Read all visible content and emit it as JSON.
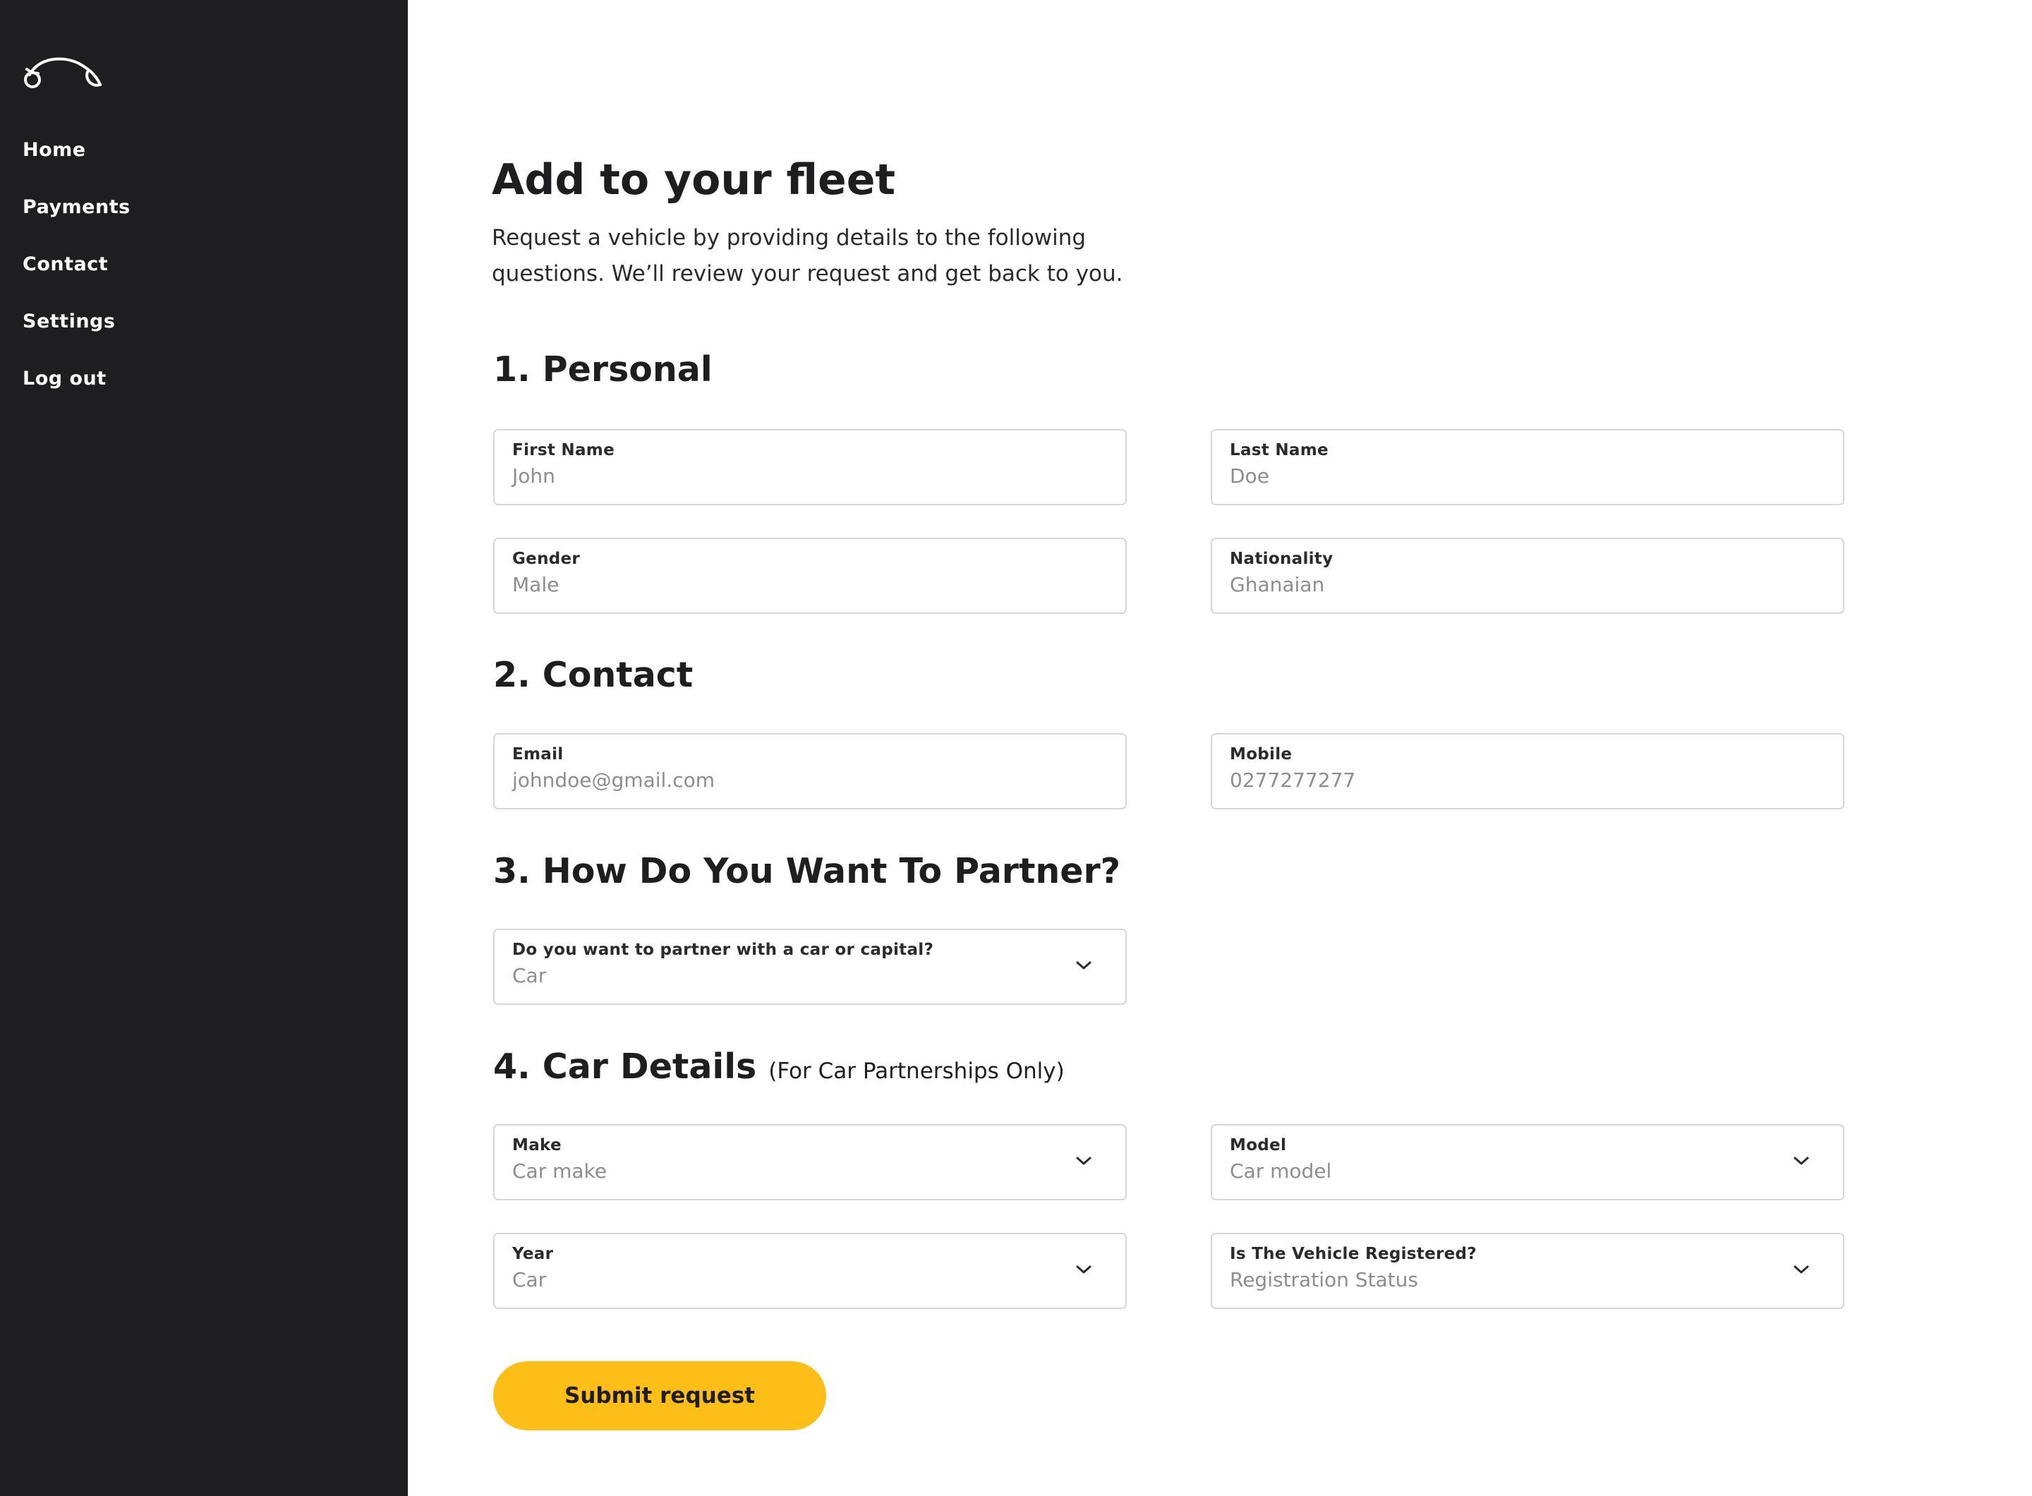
{
  "sidebar": {
    "logo_icon": "car-outline-logo-icon",
    "items": [
      {
        "label": "Home"
      },
      {
        "label": "Payments"
      },
      {
        "label": "Contact"
      },
      {
        "label": "Settings"
      },
      {
        "label": "Log out"
      }
    ]
  },
  "page": {
    "title": "Add to your fleet",
    "description_line1": "Request a vehicle by providing details to the following",
    "description_line2": "questions. We’ll review your request and get back to you."
  },
  "sections": {
    "personal": {
      "title": "1. Personal",
      "first_name": {
        "label": "First Name",
        "value": "John"
      },
      "last_name": {
        "label": "Last Name",
        "value": "Doe"
      },
      "gender": {
        "label": "Gender",
        "value": "Male"
      },
      "nationality": {
        "label": "Nationality",
        "value": "Ghanaian"
      }
    },
    "contact": {
      "title": "2. Contact",
      "email": {
        "label": "Email",
        "value": "johndoe@gmail.com"
      },
      "mobile": {
        "label": "Mobile",
        "value": "0277277277"
      }
    },
    "partner": {
      "title": "3. How Do You Want To Partner?",
      "partner_type": {
        "label": "Do you want to partner with a car or capital?",
        "value": "Car"
      }
    },
    "car": {
      "title": "4. Car Details",
      "note": "(For Car Partnerships Only)",
      "make": {
        "label": "Make",
        "value": "Car make"
      },
      "model": {
        "label": "Model",
        "value": "Car model"
      },
      "year": {
        "label": "Year",
        "value": "Car"
      },
      "registered": {
        "label": "Is The Vehicle Registered?",
        "value": "Registration Status"
      }
    }
  },
  "submit_label": "Submit request",
  "colors": {
    "sidebar_bg": "#1e1e20",
    "accent": "#fdbe17",
    "field_border": "#d7d7d9",
    "placeholder_text": "#8d8d90"
  }
}
